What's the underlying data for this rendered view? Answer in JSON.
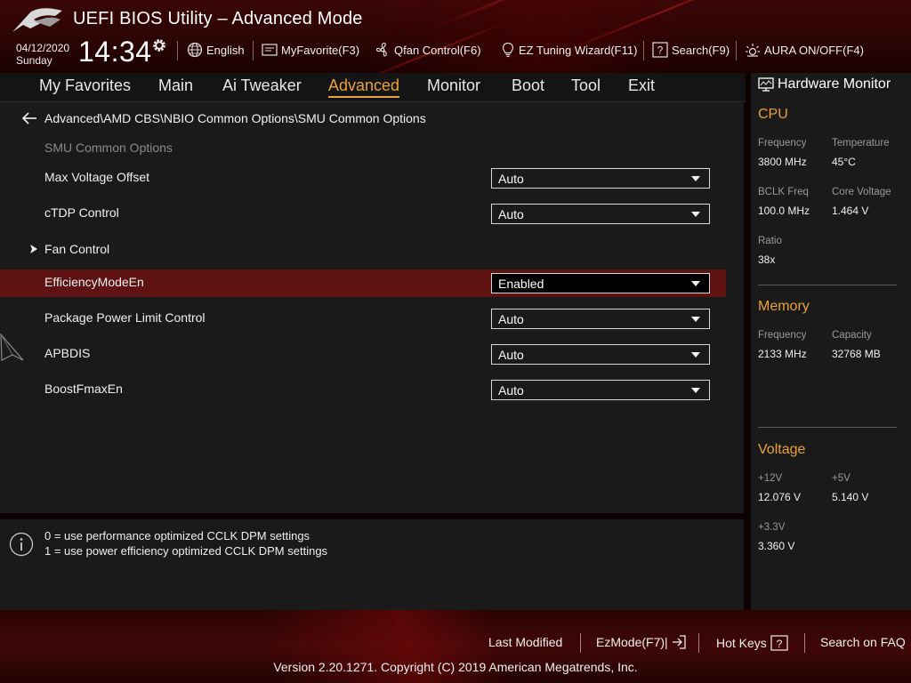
{
  "header": {
    "title": "UEFI BIOS Utility – Advanced Mode",
    "date": "04/12/2020",
    "day": "Sunday",
    "time": "14:34",
    "items": [
      {
        "label": "English",
        "icon": "globe-icon"
      },
      {
        "label": "MyFavorite(F3)",
        "icon": "favorite-icon"
      },
      {
        "label": "Qfan Control(F6)",
        "icon": "fan-icon"
      },
      {
        "label": "EZ Tuning Wizard(F11)",
        "icon": "lightbulb-icon"
      },
      {
        "label": "Search(F9)",
        "icon": "question-box-icon"
      },
      {
        "label": "AURA ON/OFF(F4)",
        "icon": "aura-icon"
      }
    ]
  },
  "nav": {
    "tabs": [
      "My Favorites",
      "Main",
      "Ai Tweaker",
      "Advanced",
      "Monitor",
      "Boot",
      "Tool",
      "Exit"
    ],
    "active": "Advanced"
  },
  "main": {
    "breadcrumb": "Advanced\\AMD CBS\\NBIO Common Options\\SMU Common Options",
    "section_title": "SMU Common Options",
    "rows": [
      {
        "label": "Max Voltage Offset",
        "value": "Auto"
      },
      {
        "label": "cTDP Control",
        "value": "Auto"
      },
      {
        "label": "Fan Control",
        "submenu": true
      },
      {
        "label": "EfficiencyModeEn",
        "value": "Enabled",
        "selected": true
      },
      {
        "label": "Package Power Limit Control",
        "value": "Auto"
      },
      {
        "label": "APBDIS",
        "value": "Auto"
      },
      {
        "label": "BoostFmaxEn",
        "value": "Auto"
      }
    ]
  },
  "help": {
    "lines": [
      "0 = use performance optimized CCLK DPM settings",
      "1 = use power efficiency optimized CCLK DPM settings"
    ]
  },
  "hardware_monitor": {
    "title": "Hardware Monitor",
    "cpu": {
      "heading": "CPU",
      "frequency_label": "Frequency",
      "frequency": "3800 MHz",
      "temperature_label": "Temperature",
      "temperature": "45°C",
      "bclk_label": "BCLK Freq",
      "bclk": "100.0 MHz",
      "core_voltage_label": "Core Voltage",
      "core_voltage": "1.464 V",
      "ratio_label": "Ratio",
      "ratio": "38x"
    },
    "memory": {
      "heading": "Memory",
      "frequency_label": "Frequency",
      "frequency": "2133 MHz",
      "capacity_label": "Capacity",
      "capacity": "32768 MB"
    },
    "voltage": {
      "heading": "Voltage",
      "v12_label": "+12V",
      "v12": "12.076 V",
      "v5_label": "+5V",
      "v5": "5.140 V",
      "v33_label": "+3.3V",
      "v33": "3.360 V"
    }
  },
  "footer": {
    "last_modified": "Last Modified",
    "ezmode": "EzMode(F7)|",
    "hot_keys": "Hot Keys",
    "search_faq": "Search on FAQ",
    "copyright": "Version 2.20.1271. Copyright (C) 2019 American Megatrends, Inc."
  },
  "colors": {
    "accent": "#e9a23b",
    "highlight_row": "#5e1212",
    "panel": "#1a1a1a",
    "brand_red": "#400707"
  }
}
